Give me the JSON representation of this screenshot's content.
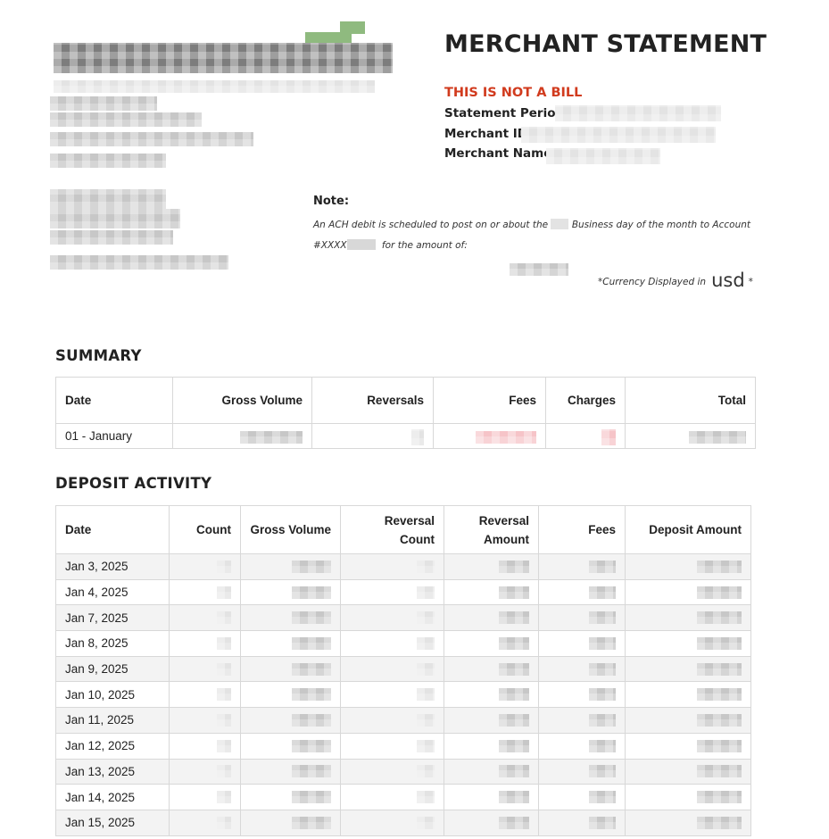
{
  "document": {
    "title": "MERCHANT STATEMENT",
    "notice": "THIS IS NOT A BILL",
    "statement_period_label": "Statement Period:",
    "merchant_id_label": "Merchant ID:",
    "merchant_name_label": "Merchant Name:"
  },
  "note": {
    "title": "Note:",
    "line1_a": "An ACH debit is scheduled to post on or about the",
    "line1_b": "Business day of the month to Account",
    "line2_a": "#XXXX",
    "line2_b": "for the amount of:",
    "currency_prefix": "*Currency Displayed in",
    "currency_unit": "usd",
    "currency_suffix": "*"
  },
  "summary": {
    "title": "SUMMARY",
    "headers": [
      "Date",
      "Gross Volume",
      "Reversals",
      "Fees",
      "Charges",
      "Total"
    ],
    "rows": [
      {
        "date": "01 - January"
      }
    ]
  },
  "deposit": {
    "title": "DEPOSIT ACTIVITY",
    "headers": [
      "Date",
      "Count",
      "Gross Volume",
      "Reversal Count",
      "Reversal Amount",
      "Fees",
      "Deposit Amount"
    ],
    "dates": [
      "Jan 3, 2025",
      "Jan 4, 2025",
      "Jan 7, 2025",
      "Jan 8, 2025",
      "Jan 9, 2025",
      "Jan 10, 2025",
      "Jan 11, 2025",
      "Jan 12, 2025",
      "Jan 13, 2025",
      "Jan 14, 2025",
      "Jan 15, 2025"
    ]
  },
  "colors": {
    "notice_red": "#d13b1e",
    "text": "#222222",
    "logo_green": "#8fba7f"
  }
}
